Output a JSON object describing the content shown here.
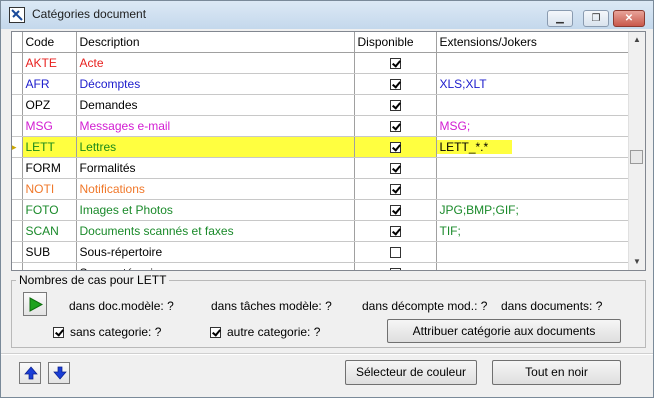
{
  "window": {
    "title": "Catégories document",
    "minimize_glyph": "▁",
    "restore_glyph": "❐",
    "close_glyph": "✕"
  },
  "table": {
    "headers": {
      "code": "Code",
      "description": "Description",
      "available": "Disponible",
      "extensions": "Extensions/Jokers"
    },
    "rows": [
      {
        "code": "AKTE",
        "description": "Acte",
        "available": true,
        "extensions": "",
        "color": "#e8211f"
      },
      {
        "code": "AFR",
        "description": "Décomptes",
        "available": true,
        "extensions": "XLS;XLT",
        "color": "#1c1ccc"
      },
      {
        "code": "OPZ",
        "description": "Demandes",
        "available": true,
        "extensions": "",
        "color": "#000000"
      },
      {
        "code": "MSG",
        "description": "Messages e-mail",
        "available": true,
        "extensions": "MSG;",
        "color": "#d21cd2"
      },
      {
        "code": "LETT",
        "description": "Lettres",
        "available": true,
        "extensions": "LETT_*.*",
        "color": "#1a8a1a",
        "selected": true
      },
      {
        "code": "FORM",
        "description": "Formalités",
        "available": true,
        "extensions": "",
        "color": "#000000"
      },
      {
        "code": "NOTI",
        "description": "Notifications",
        "available": true,
        "extensions": "",
        "color": "#f0782a"
      },
      {
        "code": "FOTO",
        "description": "Images et Photos",
        "available": true,
        "extensions": "JPG;BMP;GIF;",
        "color": "#1a8a2a"
      },
      {
        "code": "SCAN",
        "description": "Documents scannés et faxes",
        "available": true,
        "extensions": "TIF;",
        "color": "#1a8a2a"
      },
      {
        "code": "SUB",
        "description": "Sous-répertoire",
        "available": false,
        "extensions": "",
        "color": "#000000"
      },
      {
        "code": "",
        "description": "Sans catégorie",
        "available": true,
        "extensions": "",
        "color": "#000000"
      }
    ],
    "selection_color": "#ffff40",
    "current_row_marker": "▸"
  },
  "group": {
    "legend": "Nombres de cas pour LETT",
    "doc_model": "dans doc.modèle: ?",
    "task_model": "dans tâches modèle: ?",
    "settlement_model": "dans décompte mod.: ?",
    "documents": "dans documents: ?",
    "without_category": "sans categorie: ?",
    "other_category": "autre categorie: ?",
    "assign_button": "Attribuer catégorie aux documents",
    "play_icon": "play-icon"
  },
  "footer": {
    "color_picker_button": "Sélecteur de couleur",
    "all_black_button": "Tout en noir",
    "up_icon": "arrow-up-icon",
    "down_icon": "arrow-down-icon"
  }
}
